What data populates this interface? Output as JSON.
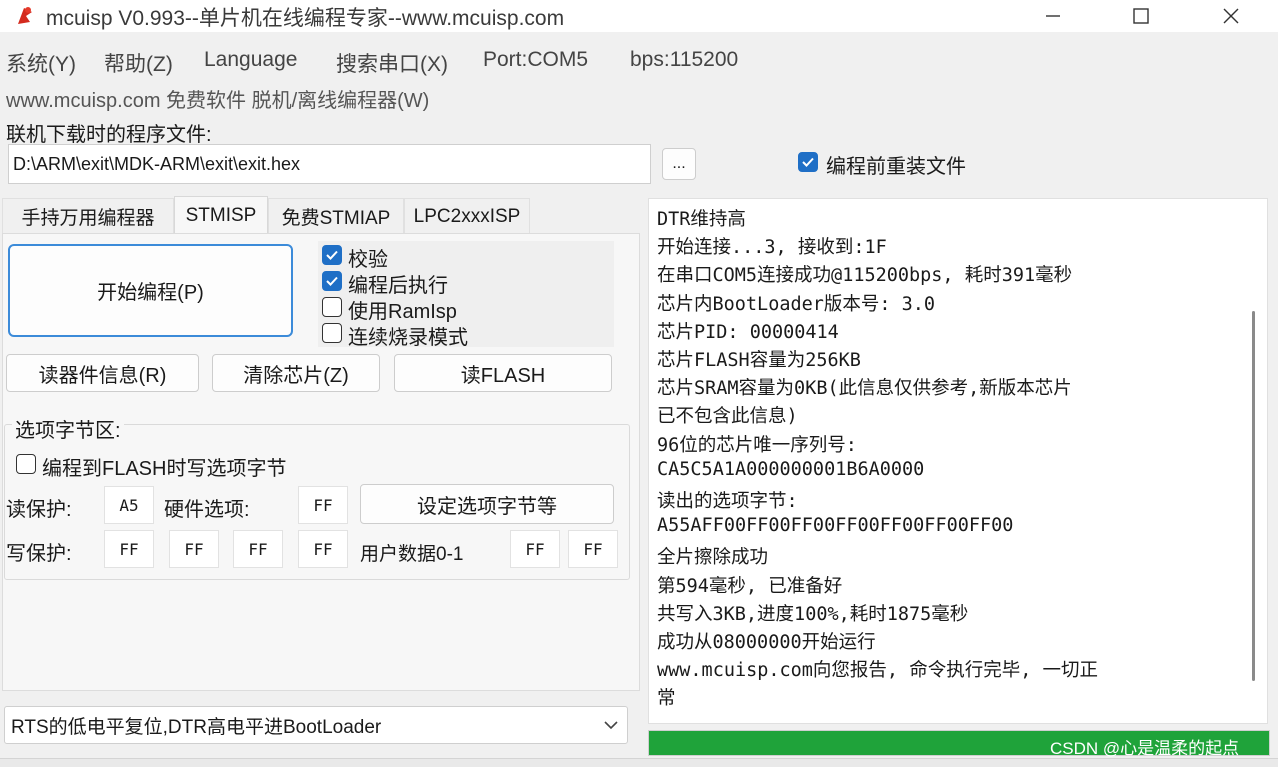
{
  "window": {
    "title": "mcuisp V0.993--单片机在线编程专家--www.mcuisp.com",
    "icon": "app-logo-icon",
    "controls": [
      "minimize-icon",
      "maximize-icon",
      "close-icon"
    ]
  },
  "menu": {
    "system": "系统(Y)",
    "help": "帮助(Z)",
    "language": "Language",
    "search_port": "搜索串口(X)",
    "port": "Port:COM5",
    "bps": "bps:115200",
    "offline": "www.mcuisp.com 免费软件 脱机/离线编程器(W)"
  },
  "file": {
    "label": "联机下载时的程序文件:",
    "path": "D:\\ARM\\exit\\MDK-ARM\\exit\\exit.hex",
    "browse_label": "...",
    "reload_label": "编程前重装文件",
    "reload_checked": true
  },
  "tabs": [
    {
      "label": "手持万用编程器",
      "active": false
    },
    {
      "label": "STMISP",
      "active": true
    },
    {
      "label": "免费STMIAP",
      "active": false
    },
    {
      "label": "LPC2xxxISP",
      "active": false
    }
  ],
  "actions": {
    "start": "开始编程(P)",
    "read_info": "读器件信息(R)",
    "erase": "清除芯片(Z)",
    "read_flash": "读FLASH"
  },
  "options": [
    {
      "label": "校验",
      "checked": true
    },
    {
      "label": "编程后执行",
      "checked": true
    },
    {
      "label": "使用RamIsp",
      "checked": false
    },
    {
      "label": "连续烧录模式",
      "checked": false
    }
  ],
  "option_bytes": {
    "title": "选项字节区:",
    "write_on_flash_label": "编程到FLASH时写选项字节",
    "write_on_flash_checked": false,
    "read_protect_label": "读保护:",
    "read_protect_value": "A5",
    "hw_option_label": "硬件选项:",
    "hw_option_value": "FF",
    "set_button": "设定选项字节等",
    "write_protect_label": "写保护:",
    "write_protect_values": [
      "FF",
      "FF",
      "FF",
      "FF"
    ],
    "user_data_label": "用户数据0-1",
    "user_data_values": [
      "FF",
      "FF"
    ]
  },
  "reset_mode": {
    "selected": "RTS的低电平复位,DTR高电平进BootLoader"
  },
  "log": [
    "DTR维持高",
    "开始连接...3, 接收到:1F",
    "在串口COM5连接成功@115200bps, 耗时391毫秒",
    "芯片内BootLoader版本号: 3.0",
    "芯片PID: 00000414",
    "芯片FLASH容量为256KB",
    "芯片SRAM容量为0KB(此信息仅供参考,新版本芯片",
    "已不包含此信息)",
    "96位的芯片唯一序列号:",
    "CA5C5A1A000000001B6A0000",
    "读出的选项字节:",
    "A55AFF00FF00FF00FF00FF00FF00FF00",
    "全片擦除成功",
    "第594毫秒, 已准备好",
    "共写入3KB,进度100%,耗时1875毫秒",
    "成功从08000000开始运行",
    "www.mcuisp.com向您报告, 命令执行完毕, 一切正",
    "常"
  ],
  "progress": {
    "fraction": 1.0,
    "color": "#1fa33a"
  },
  "watermark": "CSDN @心是温柔的起点",
  "colors": {
    "accent": "#1f6fc6",
    "progress": "#1fa33a"
  }
}
